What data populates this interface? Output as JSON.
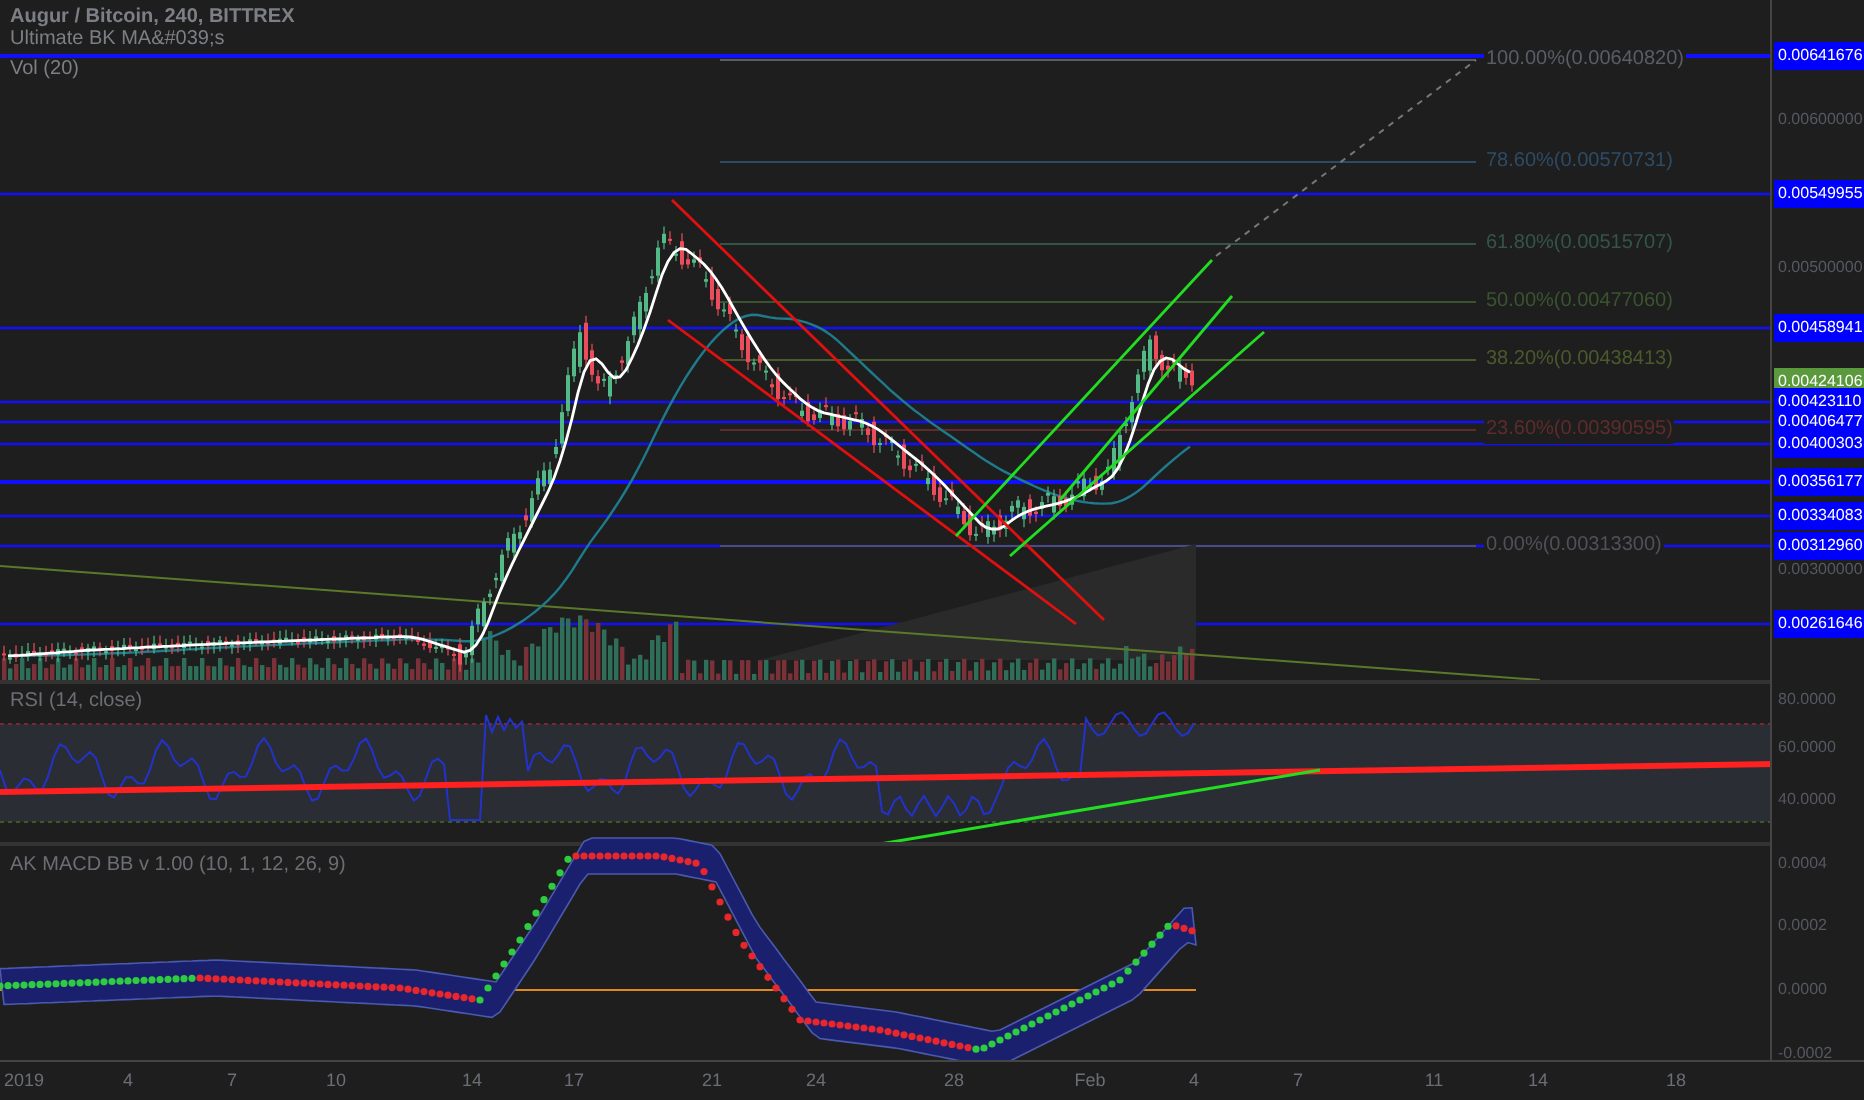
{
  "legend": [
    {
      "text": "Augur / Bitcoin, 240, BITTREX",
      "kind": "title"
    },
    {
      "text": "Ultimate BK MA&#039;s",
      "kind": "study"
    },
    {
      "text": "Vol (20)",
      "kind": "study"
    }
  ],
  "price_axis": [
    {
      "text": "0.00641676",
      "kind": "level"
    },
    {
      "text": "0.00600000",
      "kind": "tick"
    },
    {
      "text": "0.00549955",
      "kind": "level"
    },
    {
      "text": "0.00500000",
      "kind": "tick"
    },
    {
      "text": "0.00458941",
      "kind": "level"
    },
    {
      "text": "0.00424106",
      "kind": "last"
    },
    {
      "text": "0.00423110",
      "kind": "level"
    },
    {
      "text": "0.00406477",
      "kind": "level"
    },
    {
      "text": "0.00400303",
      "kind": "level"
    },
    {
      "text": "0.00356177",
      "kind": "level"
    },
    {
      "text": "0.00334083",
      "kind": "level"
    },
    {
      "text": "0.00312960",
      "kind": "level"
    },
    {
      "text": "0.00300000",
      "kind": "tick"
    },
    {
      "text": "0.00261646",
      "kind": "level"
    }
  ],
  "fib_levels": [
    {
      "label": "100.00%(0.00640820)",
      "color": "#5a5d66"
    },
    {
      "label": "78.60%(0.00570731)",
      "color": "#2e4b66"
    },
    {
      "label": "61.80%(0.00515707)",
      "color": "#34544a"
    },
    {
      "label": "50.00%(0.00477060)",
      "color": "#3a5430"
    },
    {
      "label": "38.20%(0.00438413)",
      "color": "#4a5a2c"
    },
    {
      "label": "23.60%(0.00390595)",
      "color": "#5e2c2c"
    },
    {
      "label": "0.00%(0.00313300)",
      "color": "#4f5158"
    }
  ],
  "rsi": {
    "title": "RSI (14, close)",
    "axis": [
      "80.0000",
      "60.0000",
      "40.0000"
    ]
  },
  "macd": {
    "title": "AK MACD BB v 1.00 (10, 1, 12, 26, 9)",
    "axis": [
      "0.0004",
      "0.0002",
      "0.0000",
      "-0.0002"
    ]
  },
  "time_axis": [
    "2019",
    "4",
    "7",
    "10",
    "14",
    "17",
    "21",
    "24",
    "28",
    "Feb",
    "4",
    "7",
    "11",
    "14",
    "18"
  ]
}
